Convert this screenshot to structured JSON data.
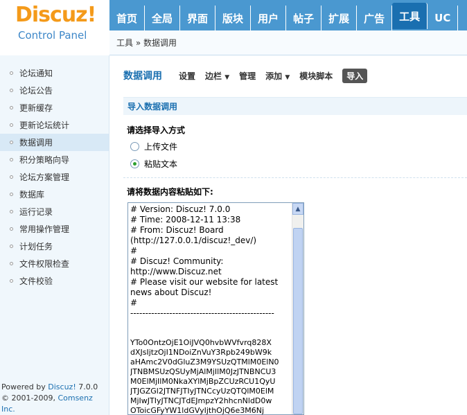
{
  "logo": {
    "brand": "Discuz!",
    "subtitle": "Control Panel"
  },
  "nav": {
    "items": [
      "首页",
      "全局",
      "界面",
      "版块",
      "用户",
      "帖子",
      "扩展",
      "广告",
      "工具",
      "UC"
    ],
    "active": "工具"
  },
  "breadcrumb": "工具 » 数据调用",
  "sidebar": {
    "items": [
      "论坛通知",
      "论坛公告",
      "更新缓存",
      "更新论坛统计",
      "数据调用",
      "积分策略向导",
      "论坛方案管理",
      "数据库",
      "运行记录",
      "常用操作管理",
      "计划任务",
      "文件权限检查",
      "文件校验"
    ],
    "active": "数据调用"
  },
  "footer": {
    "powered_prefix": "Powered by ",
    "powered_brand": "Discuz!",
    "powered_version": " 7.0.0",
    "copyright_prefix": "© 2001-2009, ",
    "copyright_brand": "Comsenz Inc."
  },
  "subnav": {
    "title": "数据调用",
    "items": [
      "设置",
      "边栏",
      "管理",
      "添加",
      "模块脚本",
      "导入"
    ],
    "dropdown_caret": "▼"
  },
  "section": {
    "title": "导入数据调用",
    "method_label": "请选择导入方式",
    "options": [
      "上传文件",
      "粘贴文本"
    ],
    "selected": "粘贴文本",
    "paste_label": "请将数据内容粘贴如下:"
  },
  "textarea": {
    "text": "# Version: Discuz! 7.0.0\n# Time: 2008-12-11 13:38\n# From: Discuz! Board\n(http://127.0.0.1/discuz!_dev/)\n#\n# Discuz! Community:\nhttp://www.Discuz.net\n# Please visit our website for latest\nnews about Discuz!\n#\n------------------------------------------------",
    "code": "YTo0OntzOjE1OiJVQ0hvbWVfvrq828X\ndXJsIjtzOjI1NDoiZnVuY3Rpb249bW9k\naHAmc2V0dGluZ3M9YSUzQTMlM0ElN0\nJTNBMSUzQSUyMjAlMjIlM0JzJTNBNCU3\nM0ElMjIlM0NkaXYlMjBpZCUzRCU1QyU\nJTJGZGl2JTNFJTIyJTNCcyUzQTQlM0ElM\nMjIwJTIyJTNCJTdEJmpzY2hhcnNldD0w\nOToicGFyYW1ldGVyIjthOjQ6e3M6Nj",
    "scroll_up_glyph": "▲"
  }
}
